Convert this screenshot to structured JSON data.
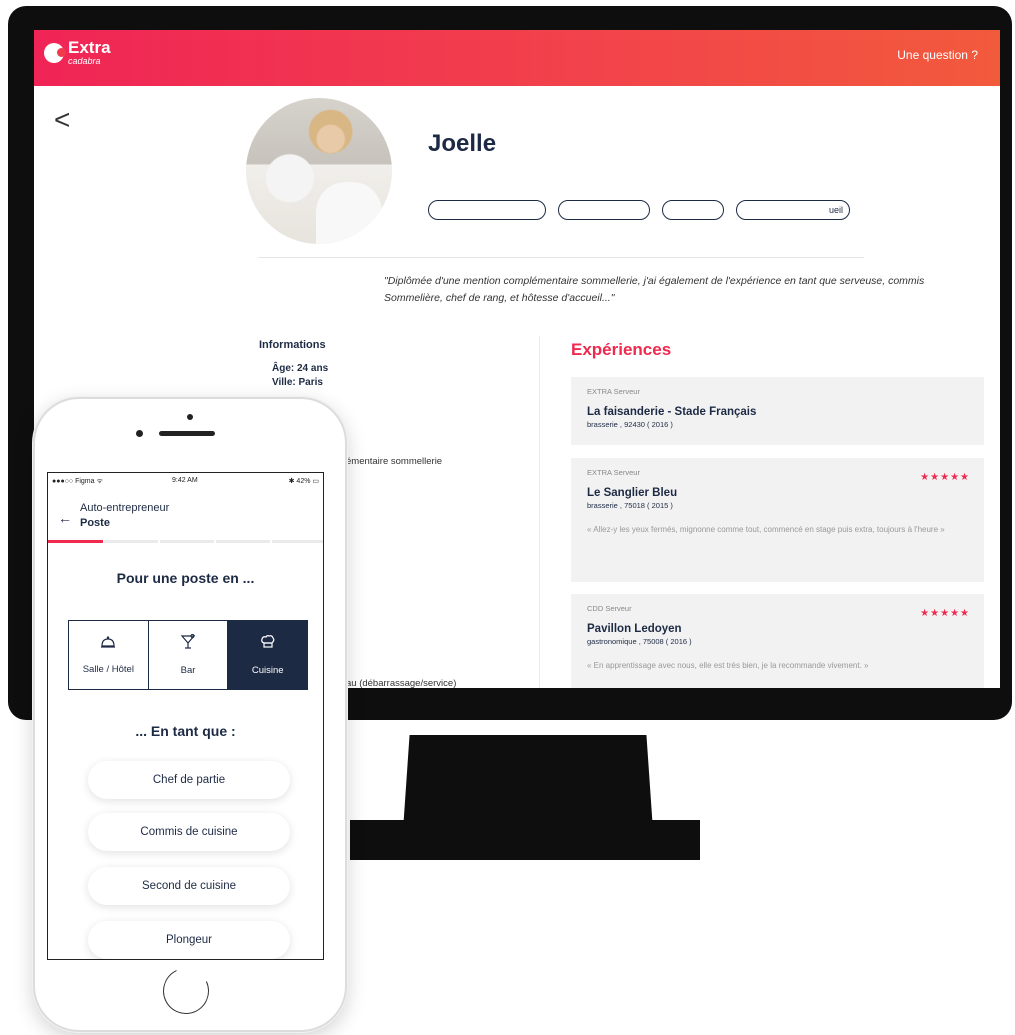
{
  "desktop": {
    "logo": {
      "word": "Extra",
      "sub": "cadabra"
    },
    "topbar_link": "Une question ?",
    "back_glyph": "<",
    "profile": {
      "name": "Joelle",
      "tags": [
        "",
        "",
        "",
        "ueil"
      ],
      "quote": "\"Diplômée d'une mention complémentaire sommellerie, j'ai également de l'expérience en tant que serveuse, commis Sommelière, chef de rang, et hôtesse d'accueil...\""
    },
    "informations": {
      "title": "Informations",
      "age": "Âge: 24 ans",
      "city": "Ville: Paris",
      "diploma_fragment": "émentaire sommellerie",
      "task_fragment": "au (débarrassage/service)"
    },
    "experiences": {
      "title": "Expériences",
      "items": [
        {
          "role": "EXTRA Serveur",
          "company": "La faisanderie - Stade Français",
          "meta": "brasserie , 92430 ( 2016 )",
          "stars": "",
          "review": ""
        },
        {
          "role": "EXTRA Serveur",
          "company": "Le Sanglier Bleu",
          "meta": "brasserie , 75018 ( 2015 )",
          "stars": "★★★★★",
          "review": "« Allez-y les yeux fermés, mignonne comme tout, commencé en stage puis extra, toujours à l'heure »"
        },
        {
          "role": "CDD Serveur",
          "company": "Pavillon Ledoyen",
          "meta": "gastronomique , 75008 ( 2016 )",
          "stars": "★★★★★",
          "review": "« En apprentissage avec nous, elle est très bien, je la recommande vivement. »"
        }
      ]
    },
    "colors": {
      "accent": "#f0294f",
      "navy": "#1d2a44"
    }
  },
  "mobile": {
    "status": {
      "carrier": "●●●○○ Figma ᯤ",
      "time": "9:42 AM",
      "battery": "✱ 42% ▭"
    },
    "nav": {
      "back_glyph": "←",
      "subtitle": "Auto-entrepreneur",
      "title": "Poste"
    },
    "progress": {
      "step": 1,
      "total": 5,
      "fraction": 0.2
    },
    "heading_poste": "Pour une poste en ...",
    "categories": [
      {
        "label": "Salle / Hôtel",
        "icon": "cloche-icon",
        "glyph": "🛎"
      },
      {
        "label": "Bar",
        "icon": "cocktail-icon",
        "glyph": "🍸"
      },
      {
        "label": "Cuisine",
        "icon": "chef-hat-icon",
        "glyph": "⛑",
        "active": true
      }
    ],
    "heading_role": "... En tant que :",
    "roles": [
      "Chef de partie",
      "Commis de cuisine",
      "Second de cuisine",
      "Plongeur"
    ]
  }
}
